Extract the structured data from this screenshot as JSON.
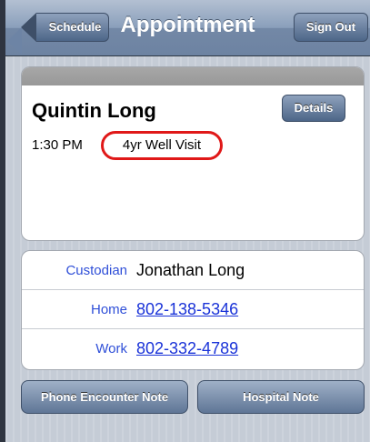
{
  "navbar": {
    "title": "Appointment",
    "back_label": "Schedule",
    "signout_label": "Sign Out"
  },
  "appointment": {
    "patient_name": "Quintin Long",
    "details_label": "Details",
    "time": "1:30 PM",
    "visit_type": "4yr Well Visit"
  },
  "contacts": [
    {
      "label": "Custodian",
      "value": "Jonathan Long"
    },
    {
      "label": "Home",
      "value": "802-138-5346"
    },
    {
      "label": "Work",
      "value": "802-332-4789"
    }
  ],
  "actions": {
    "phone_note_label": "Phone Encounter Note",
    "hospital_note_label": "Hospital Note"
  },
  "colors": {
    "highlight_circle": "#e01818",
    "link": "#1a33d8",
    "label": "#2f4fd8"
  }
}
